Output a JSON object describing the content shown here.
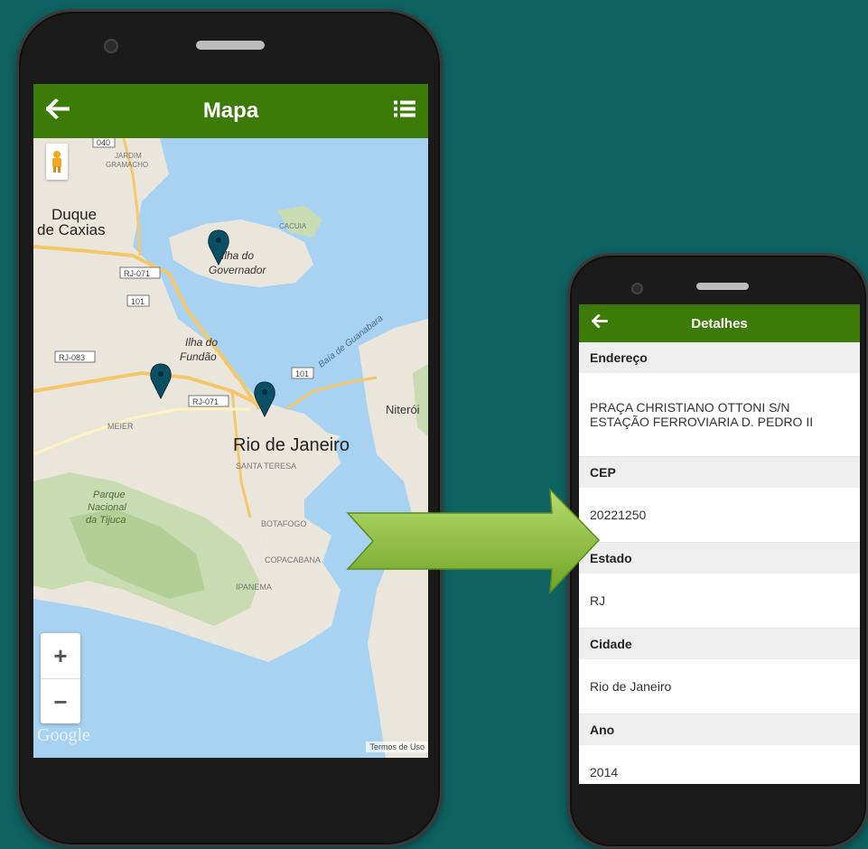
{
  "map_screen": {
    "title": "Mapa",
    "back_icon": "arrow-left-icon",
    "menu_icon": "list-icon",
    "labels": {
      "duque": "Duque",
      "caxias": "de Caxias",
      "ilha_gov_1": "Ilha do",
      "ilha_gov_2": "Governador",
      "ilha_fundao_1": "Ilha do",
      "ilha_fundao_2": "Fundão",
      "baia": "Baía de Guanabara",
      "niteroi": "Niterói",
      "rio": "Rio de Janeiro",
      "santa_teresa": "SANTA TERESA",
      "botafogo": "BOTAFOGO",
      "copacabana": "COPACABANA",
      "ipanema": "IPANEMA",
      "parque_1": "Parque",
      "parque_2": "Nacional",
      "parque_3": "da Tijuca",
      "meier": "MEIER",
      "jardim": "JARDIM",
      "gramacho": "GRAMACHO",
      "cacuia": "CACUIA",
      "road_040": "040",
      "road_rj071a": "RJ-071",
      "road_101a": "101",
      "road_rj083": "RJ-083",
      "road_rj071b": "RJ-071",
      "road_101b": "101"
    },
    "zoom_in": "+",
    "zoom_out": "−",
    "google": "Google",
    "terms": "Termos de Uso"
  },
  "details_screen": {
    "title": "Detalhes",
    "back_icon": "arrow-left-icon",
    "fields": [
      {
        "label": "Endereço",
        "value_line1": "PRAÇA CHRISTIANO OTTONI S/N",
        "value_line2": "ESTAÇÃO FERROVIARIA D. PEDRO II"
      },
      {
        "label": "CEP",
        "value": "20221250"
      },
      {
        "label": "Estado",
        "value": "RJ"
      },
      {
        "label": "Cidade",
        "value": "Rio de Janeiro"
      },
      {
        "label": "Ano",
        "value": "2014"
      }
    ]
  },
  "colors": {
    "background": "#0f6262",
    "appbar": "#3d7b08",
    "water": "#a8d2f2",
    "land": "#ebe6dc",
    "arrow": "#8fc43a"
  }
}
